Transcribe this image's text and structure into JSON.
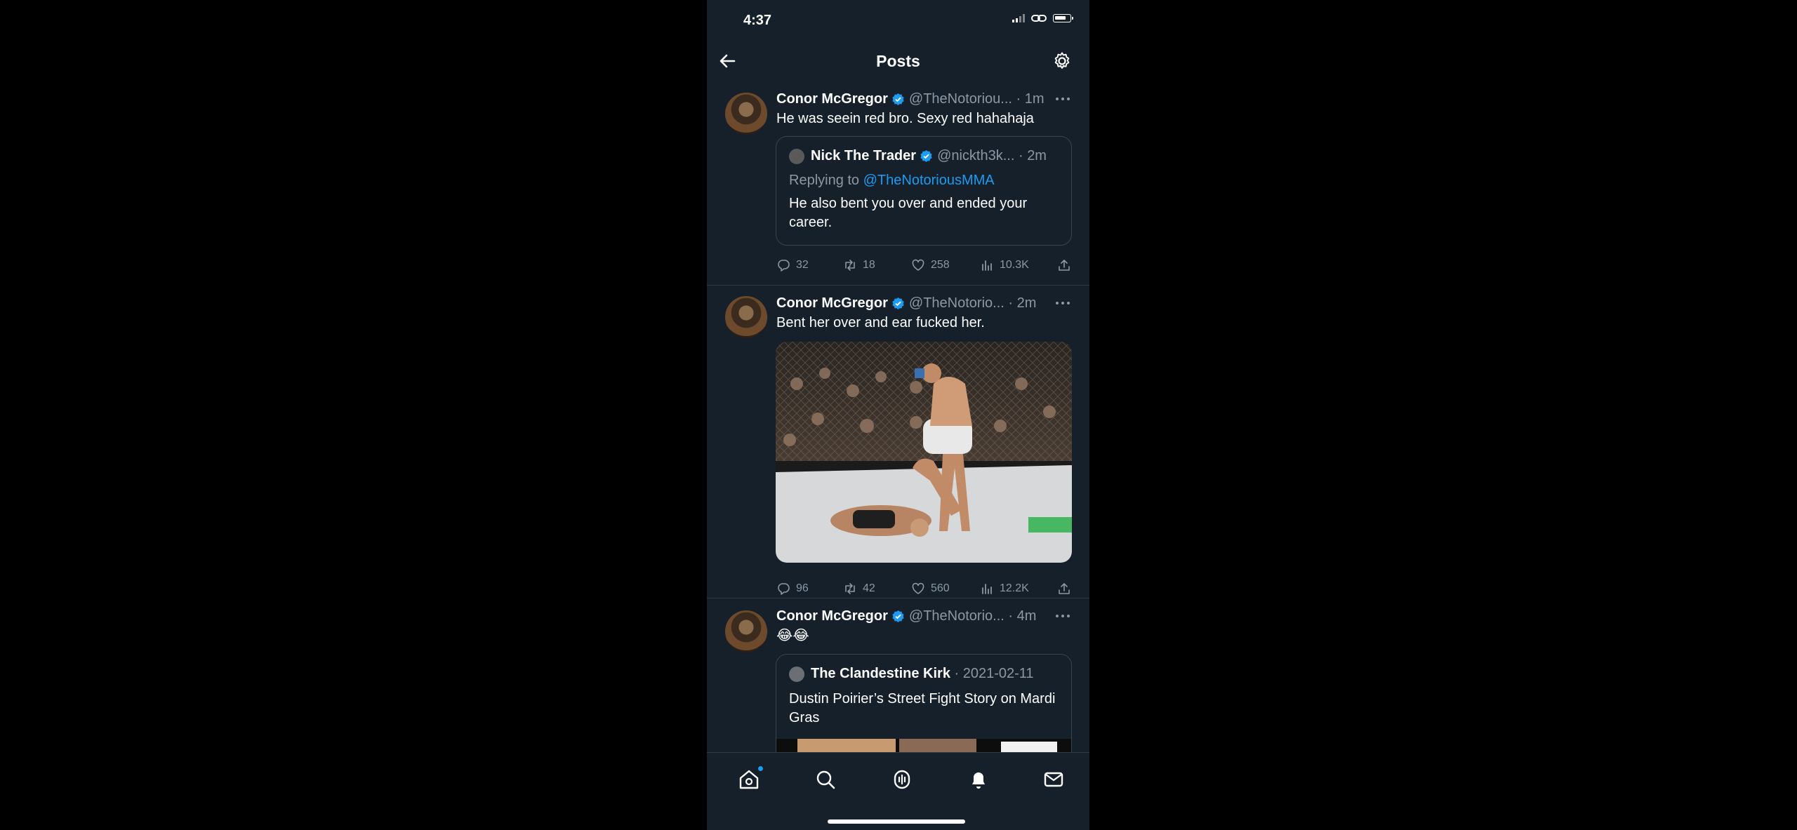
{
  "status_bar": {
    "time": "4:37"
  },
  "header": {
    "title": "Posts"
  },
  "posts": [
    {
      "name": "Conor McGregor",
      "handle": "@TheNotoriou...",
      "time": "1m",
      "text": "He was seein red bro. Sexy red hahahaja",
      "quote": {
        "name": "Nick The Trader",
        "handle": "@nickth3k...",
        "time": "2m",
        "replying_prefix": "Replying to",
        "replying_to": "@TheNotoriousMMA",
        "text": "He also bent you over and ended your career."
      },
      "stats": {
        "replies": "32",
        "retweets": "18",
        "likes": "258",
        "views": "10.3K"
      }
    },
    {
      "name": "Conor McGregor",
      "handle": "@TheNotorio...",
      "time": "2m",
      "text": "Bent her over and ear fucked her.",
      "media_description": "mma-fight-photo",
      "stats": {
        "replies": "96",
        "retweets": "42",
        "likes": "560",
        "views": "12.2K"
      }
    },
    {
      "name": "Conor McGregor",
      "handle": "@TheNotorio...",
      "time": "4m",
      "text": "😂😂",
      "quote": {
        "name": "The Clandestine Kirk",
        "time": "2021-02-11",
        "text": "Dustin Poirier’s Street Fight Story on Mardi Gras"
      }
    }
  ],
  "icons": {
    "back": "arrow-left-icon",
    "settings": "gear-icon",
    "verified": "verified-badge-icon",
    "tabs": [
      "home-icon",
      "search-icon",
      "spaces-icon",
      "notifications-icon",
      "messages-icon"
    ]
  },
  "colors": {
    "background": "#15202b",
    "accent": "#1d9bf0",
    "muted": "#8b98a5"
  }
}
